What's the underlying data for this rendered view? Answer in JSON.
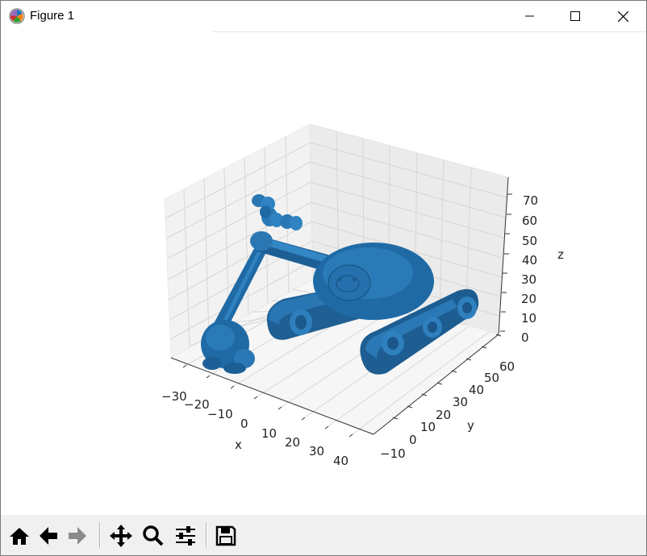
{
  "window": {
    "title": "Figure 1",
    "controls": {
      "minimize": "minimize",
      "maximize": "maximize",
      "close": "close"
    }
  },
  "axes": {
    "x": {
      "label": "x",
      "ticks": [
        "−30",
        "−20",
        "−10",
        "0",
        "10",
        "20",
        "30",
        "40"
      ]
    },
    "y": {
      "label": "y",
      "ticks": [
        "−10",
        "0",
        "10",
        "20",
        "30",
        "40",
        "50",
        "60"
      ]
    },
    "z": {
      "label": "z",
      "ticks": [
        "0",
        "10",
        "20",
        "30",
        "40",
        "50",
        "60",
        "70"
      ]
    }
  },
  "plot": {
    "type": "3d-surface",
    "subject": "tracked excavator robot",
    "color": "#1f6aa5",
    "pane_color": "#f2f2f2",
    "grid_color": "#d9d9d9"
  },
  "toolbar": {
    "buttons": [
      {
        "name": "home-button",
        "icon": "home-icon"
      },
      {
        "name": "back-button",
        "icon": "arrow-left-icon"
      },
      {
        "name": "forward-button",
        "icon": "arrow-right-icon"
      },
      {
        "name": "pan-button",
        "icon": "move-icon"
      },
      {
        "name": "zoom-button",
        "icon": "magnifier-icon"
      },
      {
        "name": "configure-button",
        "icon": "sliders-icon"
      },
      {
        "name": "save-button",
        "icon": "floppy-disk-icon"
      }
    ]
  }
}
